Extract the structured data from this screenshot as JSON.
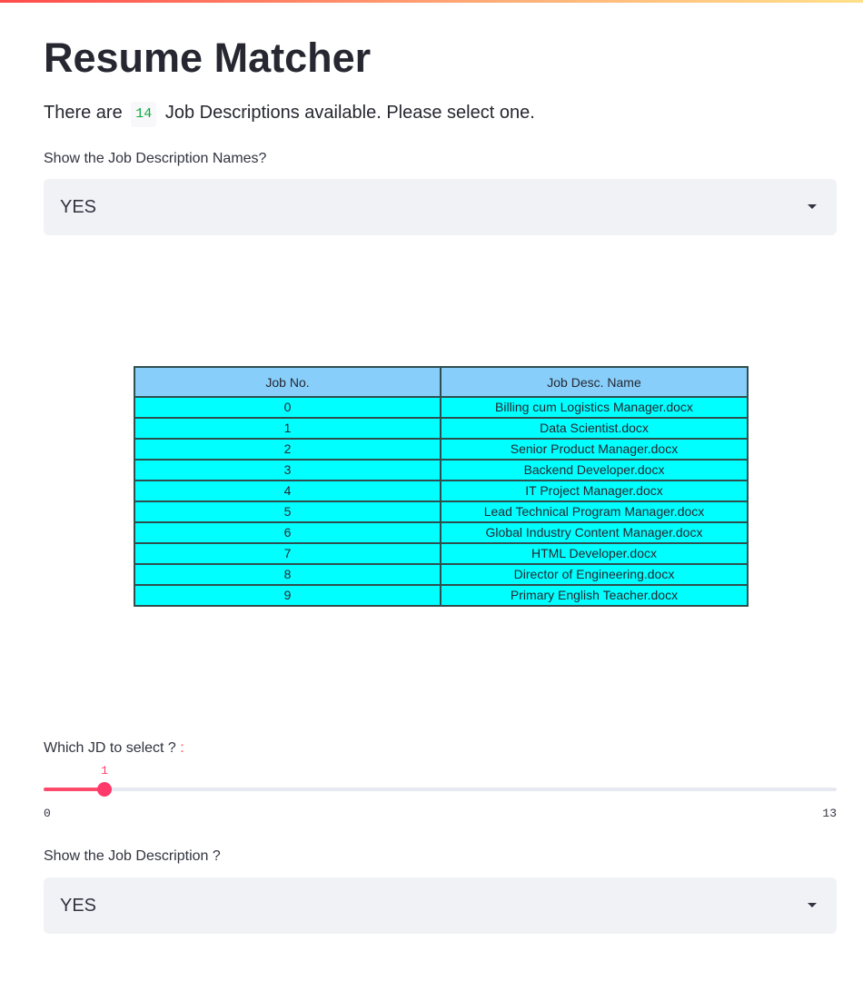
{
  "app": {
    "title": "Resume Matcher",
    "accent_color": "#ff4b4b"
  },
  "intro": {
    "before": "There are",
    "count": "14",
    "after": "Job Descriptions available. Please select one."
  },
  "show_names": {
    "label": "Show the Job Description Names?",
    "value": "YES",
    "icon": "chevron-down-icon"
  },
  "jd_table": {
    "headers": [
      "Job No.",
      "Job Desc. Name"
    ],
    "header_color": "#87cefa",
    "row_color": "#00ffff",
    "border_color": "#2f4f4f",
    "rows": [
      [
        "0",
        "Billing cum Logistics Manager.docx"
      ],
      [
        "1",
        "Data Scientist.docx"
      ],
      [
        "2",
        "Senior Product Manager.docx"
      ],
      [
        "3",
        "Backend Developer.docx"
      ],
      [
        "4",
        "IT Project Manager.docx"
      ],
      [
        "5",
        "Lead Technical Program Manager.docx"
      ],
      [
        "6",
        "Global Industry Content Manager.docx"
      ],
      [
        "7",
        "HTML Developer.docx"
      ],
      [
        "8",
        "Director of Engineering.docx"
      ],
      [
        "9",
        "Primary English Teacher.docx"
      ]
    ]
  },
  "jd_slider": {
    "label": "Which JD to select ?",
    "label_suffix": " :",
    "value": 1,
    "min": 0,
    "max": 13,
    "value_text": "1",
    "min_text": "0",
    "max_text": "13",
    "fill_color": "#ff4b6b"
  },
  "show_description": {
    "label": "Show the Job Description ?",
    "value": "YES",
    "icon": "chevron-down-icon"
  }
}
